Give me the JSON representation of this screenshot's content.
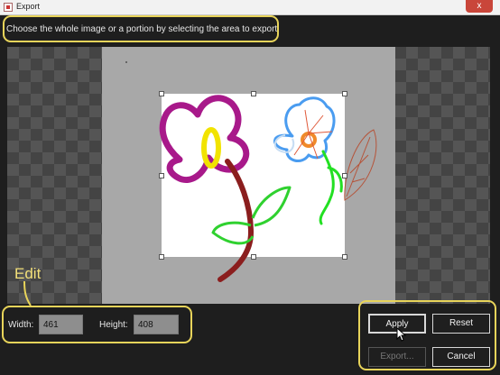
{
  "window": {
    "title": "Export",
    "close_glyph": "x"
  },
  "instruction": "Choose the whole image or a portion by selecting the area to export.",
  "annotation": {
    "edit_label": "Edit",
    "color": "#e8d45a"
  },
  "fields": {
    "width_label": "Width:",
    "width_value": "461",
    "height_label": "Height:",
    "height_value": "408"
  },
  "buttons": {
    "apply": "Apply",
    "reset": "Reset",
    "export": "Export...",
    "cancel": "Cancel"
  },
  "icons": [
    "app-icon",
    "close-icon",
    "mouse-cursor-icon"
  ],
  "colors": {
    "background": "#1e1e1e",
    "checker_dark": "#444444",
    "checker_light": "#555555",
    "canvas": "#a8a8a8"
  }
}
